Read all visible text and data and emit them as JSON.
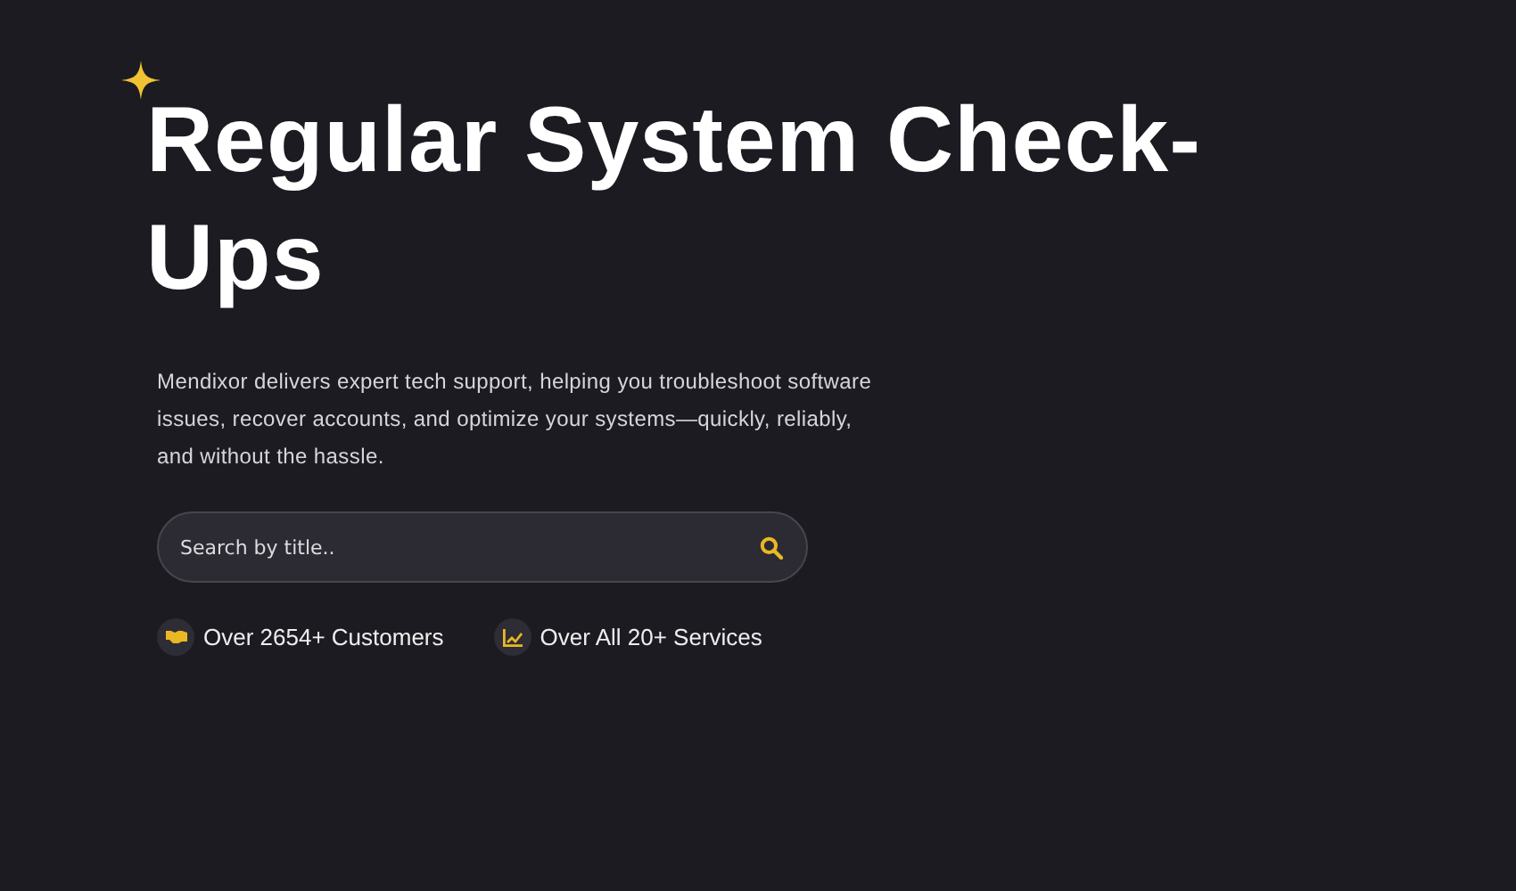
{
  "hero": {
    "title": "Regular System Check-Ups",
    "description": "Mendixor delivers expert tech support, helping you troubleshoot software issues, recover accounts, and optimize your systems—quickly, reliably, and without the hassle.",
    "search": {
      "placeholder": "Search by title.."
    },
    "stats": [
      {
        "kind": "customers",
        "label": "Over 2654+ Customers"
      },
      {
        "kind": "services",
        "label": "Over All 20+ Services"
      }
    ]
  }
}
